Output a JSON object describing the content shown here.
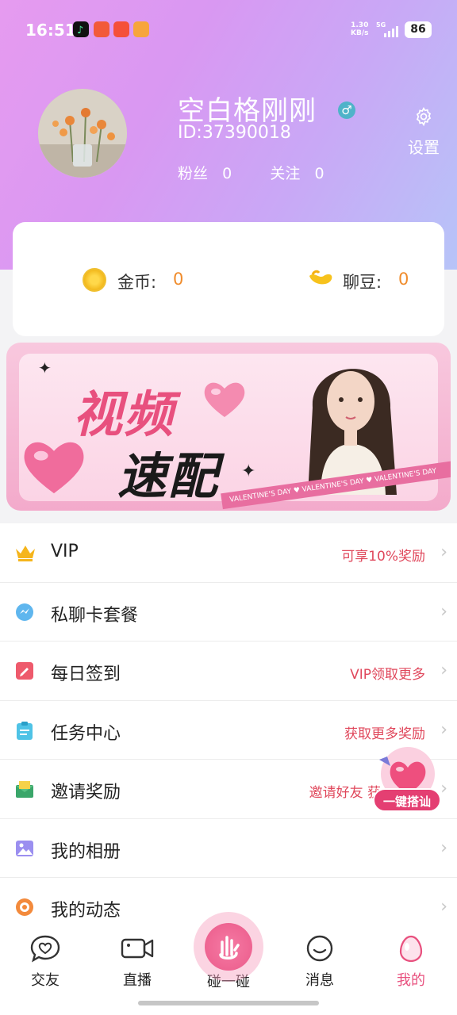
{
  "status_bar": {
    "time": "16:51",
    "net_speed_value": "1.30",
    "net_speed_unit": "KB/s",
    "network": "5G",
    "battery": "86"
  },
  "profile": {
    "nickname": "空白格刚刚",
    "gender_symbol": "♂",
    "user_id": "ID:37390018",
    "fans_label": "粉丝",
    "fans_count": "0",
    "following_label": "关注",
    "following_count": "0",
    "settings_label": "设置"
  },
  "wallet": {
    "coin_label": "金币:",
    "coin_value": "0",
    "bean_label": "聊豆:",
    "bean_value": "0"
  },
  "banner": {
    "title_line1": "视频",
    "title_line2": "速配",
    "ribbon_text": "VALENTINE'S DAY ♥ VALENTINE'S DAY ♥ VALENTINE'S DAY"
  },
  "menu": {
    "items": [
      {
        "label": "VIP",
        "note": "可享10%奖励",
        "icon": "crown-icon"
      },
      {
        "label": "私聊卡套餐",
        "note": "",
        "icon": "chat-drop-icon"
      },
      {
        "label": "每日签到",
        "note": "VIP领取更多",
        "icon": "checkin-icon"
      },
      {
        "label": "任务中心",
        "note": "获取更多奖励",
        "icon": "clipboard-icon"
      },
      {
        "label": "邀请奖励",
        "note": "邀请好友 获",
        "icon": "envelope-icon"
      },
      {
        "label": "我的相册",
        "note": "",
        "icon": "photo-icon"
      },
      {
        "label": "我的动态",
        "note": "",
        "icon": "target-icon"
      }
    ],
    "arrow": "›"
  },
  "float_button": {
    "label": "一键搭讪"
  },
  "bottom_nav": {
    "items": [
      {
        "label": "交友"
      },
      {
        "label": "直播"
      },
      {
        "label": "碰一碰"
      },
      {
        "label": "消息"
      },
      {
        "label": "我的"
      }
    ]
  },
  "colors": {
    "accent": "#e8507e",
    "note_red": "#e0485c",
    "wallet_value": "#f08c2c"
  }
}
